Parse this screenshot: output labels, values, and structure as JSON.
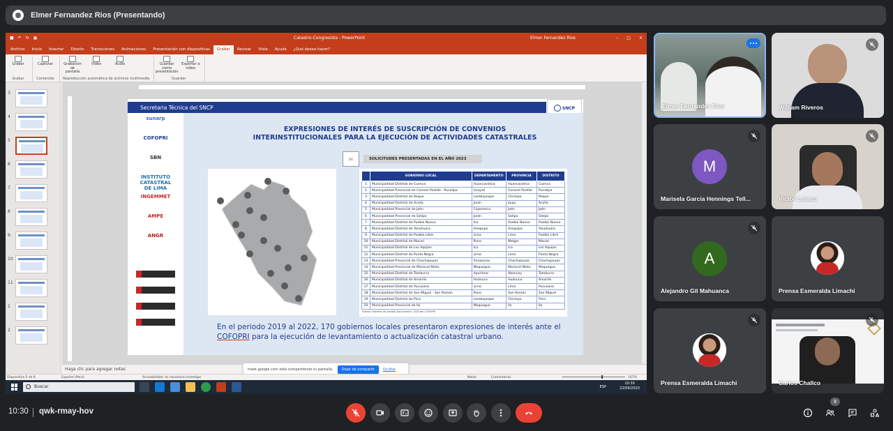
{
  "presenter": {
    "name": "Elmer Fernandez Rios (Presentando)"
  },
  "ppt": {
    "doc_title": "Catastro-Congresista - PowerPoint",
    "user": "Elmer Fernandez Rios",
    "tabs": [
      "Archivo",
      "Inicio",
      "Insertar",
      "Diseño",
      "Transiciones",
      "Animaciones",
      "Presentación con diapositivas",
      "Grabar",
      "Revisar",
      "Vista",
      "Ayuda",
      "¿Qué desea hacer?"
    ],
    "active_tab": "Grabar",
    "ribbon": {
      "groups": [
        {
          "label": "Grabar",
          "buttons": [
            "Grabar"
          ]
        },
        {
          "label": "Contenido",
          "buttons": [
            "Capturar"
          ]
        },
        {
          "label": "Reproducción automática de archivos multimedia",
          "buttons": [
            "Grabación de pantalla",
            "Vídeo",
            "Audio"
          ]
        },
        {
          "label": "Guardar",
          "buttons": [
            "Guardar como presentación",
            "Exportar a vídeo"
          ]
        }
      ]
    },
    "thumb_numbers": [
      "3",
      "4",
      "5",
      "6",
      "7",
      "8",
      "9",
      "10",
      "11",
      "1",
      "2"
    ],
    "notes_placeholder": "Haga clic para agregar notas",
    "status": {
      "slide": "Diapositiva 5 de 8",
      "language": "Español (Perú)",
      "accessibility": "Accesibilidad: es necesario investigar",
      "notes": "Notas",
      "comments": "Comentarios",
      "zoom": "107%"
    },
    "share_toast": {
      "text": "meet.google.com está compartiendo tu pantalla.",
      "stop": "Dejar de compartir",
      "hide": "Ocultar"
    },
    "taskbar": {
      "search": "Buscar",
      "time": "10:30",
      "date": "22/09/2023",
      "lang": "ESP"
    }
  },
  "slide": {
    "header": "Secretaria Técnica del SNCP",
    "snc_logo": "SNCP",
    "org_logos": [
      "sunarp",
      "COFOPRI",
      "SBN",
      "INSTITUTO CATASTRAL DE LIMA",
      "INGEMMET",
      "AMPE",
      "ANGR"
    ],
    "title_line1": "EXPRESIONES DE INTERÉS DE SUSCRIPCIÓN DE CONVENIOS",
    "title_line2": "INTERINSTITUCIONALES PARA LA EJECUCIÓN DE ACTIVIDADES CATASTRALES",
    "icon_text": "DG",
    "badge": "SOLICITUDES PRESENTADAS EN EL AÑO 2023",
    "table": {
      "headers": [
        "",
        "GOBIERNO LOCAL",
        "DEPARTAMENTO",
        "PROVINCIA",
        "DISTRITO"
      ],
      "rows": [
        [
          "1",
          "Municipalidad Distrital de Cuenca",
          "Huancavelica",
          "Huancavelica",
          "Cuenca"
        ],
        [
          "2",
          "Municipalidad Provincial de Coronel Portillo - Pucallpa",
          "Ucayali",
          "Coronel Portillo",
          "Pucallpa"
        ],
        [
          "3",
          "Municipalidad Distrital de Reque",
          "Lambayeque",
          "Chiclayo",
          "Reque"
        ],
        [
          "4",
          "Municipalidad Distrital de Acolla",
          "Junín",
          "Jauja",
          "Acolla"
        ],
        [
          "5",
          "Municipalidad Provincial de Jaén",
          "Cajamarca",
          "Jaén",
          "Jaén"
        ],
        [
          "6",
          "Municipalidad Provincial de Satipo",
          "Junín",
          "Satipo",
          "Satipo"
        ],
        [
          "7",
          "Municipalidad Distrital de Pueblo Nuevo",
          "Ica",
          "Pueblo Nuevo",
          "Pueblo Nuevo"
        ],
        [
          "8",
          "Municipalidad Distrital de Yanahuara",
          "Arequipa",
          "Arequipa",
          "Yanahuara"
        ],
        [
          "9",
          "Municipalidad Distrital de Pueblo Libre",
          "Lima",
          "Lima",
          "Pueblo Libre"
        ],
        [
          "10",
          "Municipalidad Distrital de Macarí",
          "Puno",
          "Melgar",
          "Macarí"
        ],
        [
          "11",
          "Municipalidad Distrital de Los Aquijes",
          "Ica",
          "Ica",
          "Los Aquijes"
        ],
        [
          "12",
          "Municipalidad Distrital de Punta Negra",
          "Lima",
          "Lima",
          "Punta Negra"
        ],
        [
          "13",
          "Municipalidad Provincial de Chachapoyas",
          "Amazonas",
          "Chachapoyas",
          "Chachapoyas"
        ],
        [
          "14",
          "Municipalidad Provincial de Mariscal Nieto",
          "Moquegua",
          "Mariscal Nieto",
          "Moquegua"
        ],
        [
          "15",
          "Municipalidad Distrital de Tamburco",
          "Apurímac",
          "Abancay",
          "Tamburco"
        ],
        [
          "16",
          "Municipalidad Distrital de Amarilis",
          "Huánuco",
          "Huánuco",
          "Amarilis"
        ],
        [
          "17",
          "Municipalidad Distrital de Pucusana",
          "Lima",
          "Lima",
          "Pucusana"
        ],
        [
          "18",
          "Municipalidad Distrital de San Miguel - San Román",
          "Puno",
          "San Román",
          "San Miguel"
        ],
        [
          "19",
          "Municipalidad Distrital de Picsi",
          "Lambayeque",
          "Chiclayo",
          "Picsi"
        ],
        [
          "20",
          "Municipalidad Provincial de Ilo",
          "Moquegua",
          "Ilo",
          "Ilo"
        ]
      ],
      "source": "Fuente: Sistema de Gestión Documental - SGD del COFOPRI"
    },
    "body_before": "En el periodo 2019 al 2022, 170 gobiernos locales presentaron expresiones de interés ante el ",
    "body_link": "COFOPRI",
    "body_after": " para la ejecución de levantamiento o actualización catastral urbano."
  },
  "participants": [
    {
      "name": "Elmer Fernandez Rios",
      "muted": false,
      "speaking": true
    },
    {
      "name": "William Riveros",
      "muted": true
    },
    {
      "name": "Marisela Garcia Hennings Tell...",
      "muted": true,
      "letter": "M",
      "color": "#7e57c2"
    },
    {
      "name": "Victor Loayza",
      "muted": true
    },
    {
      "name": "Alejandro Gil Mahuanca",
      "muted": true,
      "letter": "A",
      "color": "#33691e"
    },
    {
      "name": "Prensa Esmeralda Limachi",
      "muted": false
    },
    {
      "name": "Prensa Esmeralda Limachi",
      "muted": true
    },
    {
      "name": "Carlos Challco",
      "muted": true
    }
  ],
  "meeting": {
    "time": "10:30",
    "code": "qwk-rmay-hov",
    "participant_count": "9"
  },
  "icons": {
    "mic_off": "mic-off-icon",
    "camera": "camera-icon",
    "captions": "captions-icon",
    "emoji": "emoji-icon",
    "present": "present-icon",
    "hand": "raise-hand-icon",
    "more": "more-icon",
    "leave": "leave-call-icon",
    "info": "info-icon",
    "people": "people-icon",
    "chat": "chat-icon",
    "activities": "activities-icon"
  },
  "colors": {
    "ppt_accent": "#c43e1c",
    "slide_blue": "#1f3c8e",
    "meet_red": "#ea4335",
    "meet_bg": "#202124"
  }
}
